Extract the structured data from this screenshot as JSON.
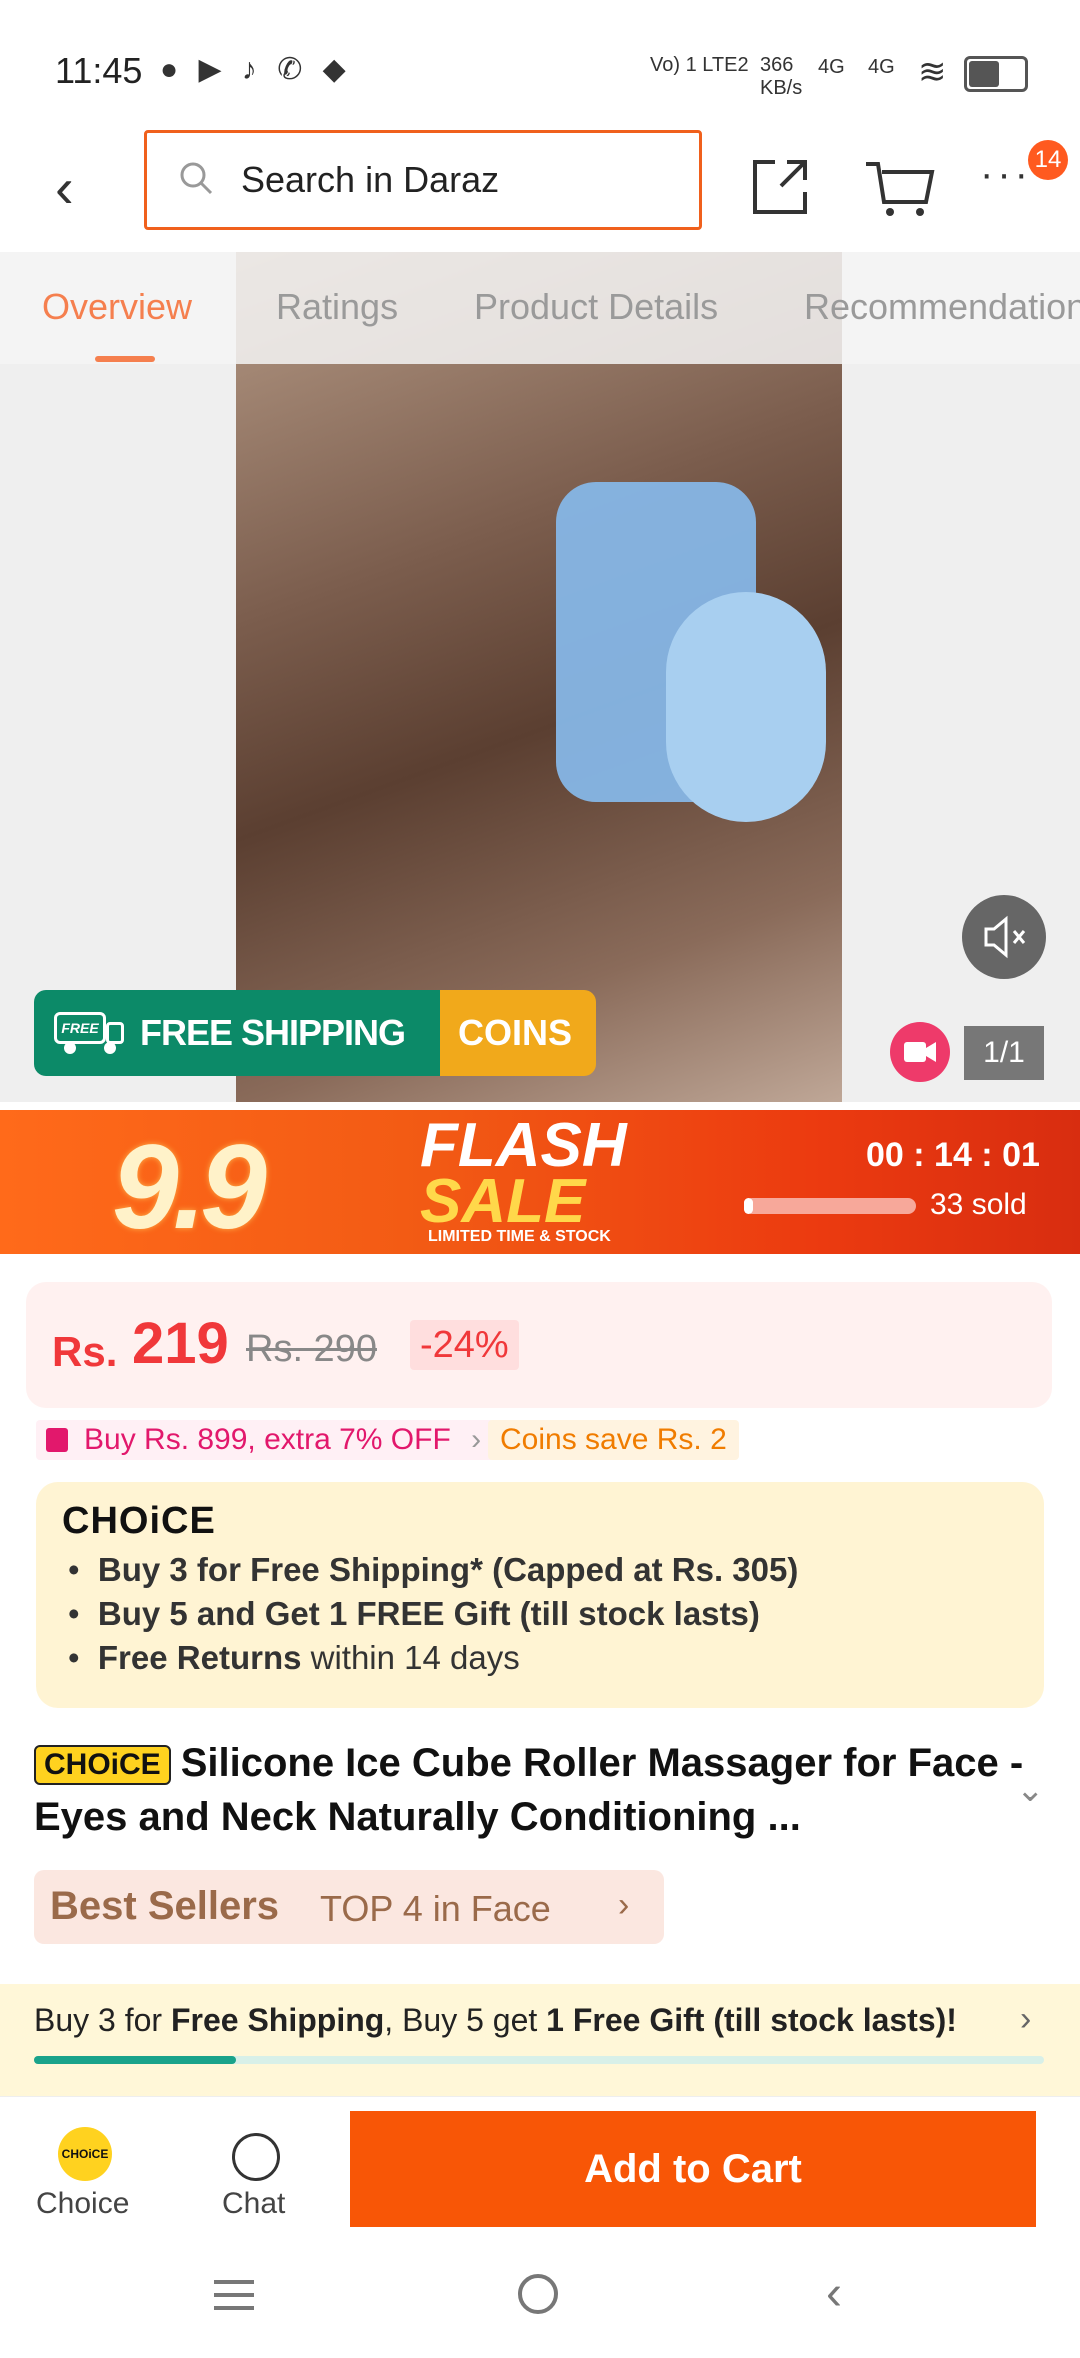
{
  "status_bar": {
    "time": "11:45",
    "network": "Vo) 1 LTE2",
    "speed": "366 KB/s",
    "sig1": "4G",
    "sig2": "4G"
  },
  "header": {
    "search_placeholder": "Search in Daraz",
    "cart_badge": "14"
  },
  "tabs": [
    {
      "label": "Overview",
      "active": true
    },
    {
      "label": "Ratings"
    },
    {
      "label": "Product Details"
    },
    {
      "label": "Recommendations"
    }
  ],
  "media": {
    "free_shipping": "FREE SHIPPING",
    "coins": "COINS",
    "free_tag": "FREE",
    "counter": "1/1"
  },
  "flash_sale": {
    "event": "9.9",
    "title_line1": "FLASH",
    "title_line2": "SALE",
    "subtitle": "LIMITED TIME & STOCK",
    "timer": "00 : 14 : 01",
    "sold": "33 sold",
    "sold_progress": 0.05
  },
  "price": {
    "currency": "Rs.",
    "current": "219",
    "original": "Rs. 290",
    "discount": "-24%"
  },
  "promos": {
    "voucher": "Buy Rs. 899, extra 7% OFF",
    "coins": "Coins save Rs. 2"
  },
  "choice": {
    "logo": "CHOiCE",
    "bullets": [
      "Buy 3 for  Free Shipping* (Capped at Rs. 305)",
      "Buy 5 and Get 1 FREE Gift (till stock lasts)"
    ],
    "returns_bold": "Free Returns",
    "returns_rest": " within 14 days"
  },
  "product": {
    "tag": "CHOiCE",
    "title": "Silicone Ice Cube Roller Massager for Face - Eyes and Neck Naturally Conditioning ..."
  },
  "best_sellers": {
    "label": "Best Sellers",
    "rank": "TOP 4 in Face"
  },
  "bottom_promo": {
    "part1": "Buy 3 for ",
    "bold1": "Free Shipping",
    "part2": ", Buy 5 get ",
    "bold2": "1 Free Gift (till stock lasts)!",
    "progress": 0.2
  },
  "bottom_bar": {
    "choice_label": "Choice",
    "choice_icon_text": "CHOiCE",
    "chat_label": "Chat",
    "add_to_cart": "Add to Cart"
  },
  "colors": {
    "brand_orange": "#f85606",
    "accent": "#f57f4e",
    "price_red": "#f0383a"
  }
}
